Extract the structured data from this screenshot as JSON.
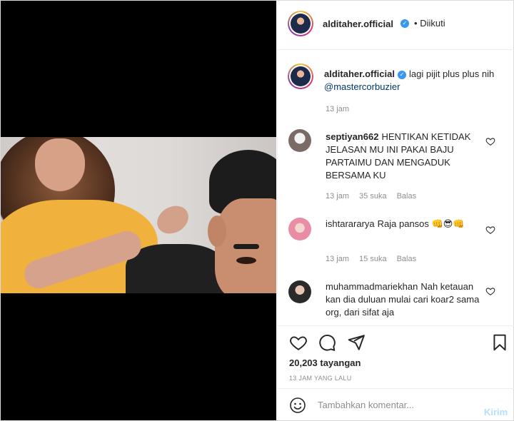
{
  "post": {
    "username": "alditaher.official",
    "follow_dot": "•",
    "follow_label": "Diikuti",
    "verified_mark": "✓"
  },
  "caption": {
    "username": "alditaher.official",
    "text": "lagi pijit plus plus nih ",
    "mention": "@mastercorbuzier",
    "time": "13 jam"
  },
  "comments": [
    {
      "username": "septiyan662",
      "text": "HENTIKAN KETIDAK JELASAN MU INI PAKAI BAJU PARTAIMU DAN MENGADUK BERSAMA KU",
      "time": "13 jam",
      "likes": "35 suka",
      "reply": "Balas"
    },
    {
      "username": "ishtarararya",
      "text": "Raja pansos 👊😎👊",
      "time": "13 jam",
      "likes": "15 suka",
      "reply": "Balas"
    },
    {
      "username": "muhammadmariekhan",
      "text": "Nah ketauan kan dia duluan mulai cari koar2 sama org, dari sifat aja",
      "time": "",
      "likes": "",
      "reply": ""
    }
  ],
  "actions": {
    "views": "20,203 tayangan",
    "posted_ago": "13 JAM YANG LALU"
  },
  "comment_box": {
    "placeholder": "Tambahkan komentar...",
    "post_label": "Kirim"
  },
  "icons": {
    "like": "heart-icon",
    "comment": "comment-icon",
    "share": "paper-plane-icon",
    "save": "bookmark-icon",
    "emoji": "smiley-icon",
    "comment_like": "heart-outline-icon"
  },
  "colors": {
    "verified": "#3897f0",
    "mention": "#00376b",
    "post_button_disabled": "#b2dffc",
    "meta_gray": "#8e8e8e"
  }
}
